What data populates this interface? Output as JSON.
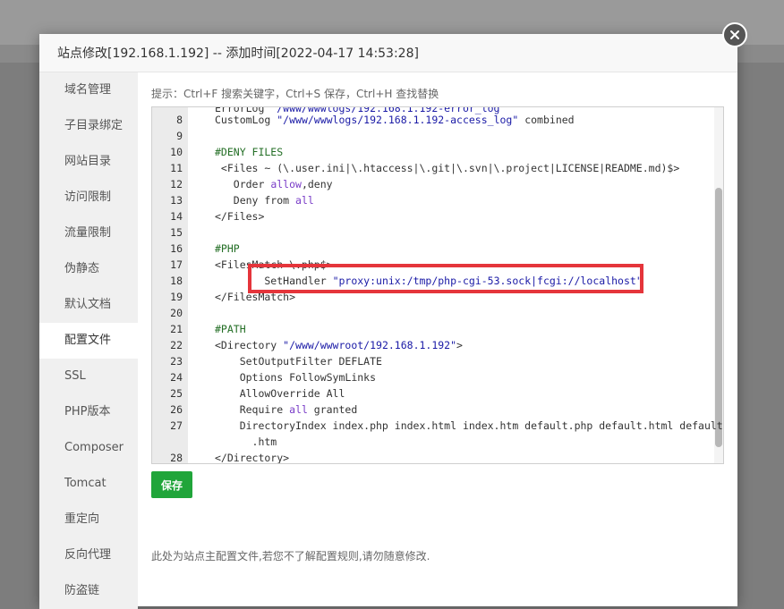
{
  "modal": {
    "title": "站点修改[192.168.1.192] -- 添加时间[2022-04-17 14:53:28]"
  },
  "sidebar": {
    "items": [
      {
        "label": "域名管理"
      },
      {
        "label": "子目录绑定"
      },
      {
        "label": "网站目录"
      },
      {
        "label": "访问限制"
      },
      {
        "label": "流量限制"
      },
      {
        "label": "伪静态"
      },
      {
        "label": "默认文档"
      },
      {
        "label": "配置文件",
        "active": true
      },
      {
        "label": "SSL"
      },
      {
        "label": "PHP版本"
      },
      {
        "label": "Composer"
      },
      {
        "label": "Tomcat"
      },
      {
        "label": "重定向"
      },
      {
        "label": "反向代理"
      },
      {
        "label": "防盗链"
      }
    ]
  },
  "editor": {
    "hint": "提示：Ctrl+F 搜索关键字，Ctrl+S 保存，Ctrl+H 查找替换",
    "partial_top_line": "ErrorLog \"/www/wwwlogs/192.168.1.192-error_log\"",
    "lines": [
      {
        "n": "8",
        "text": "CustomLog \"/www/wwwlogs/192.168.1.192-access_log\" combined"
      },
      {
        "n": "9",
        "text": ""
      },
      {
        "n": "10",
        "text": "#DENY FILES"
      },
      {
        "n": "11",
        "text": " <Files ~ (\\.user.ini|\\.htaccess|\\.git|\\.svn|\\.project|LICENSE|README.md)$>"
      },
      {
        "n": "12",
        "text": "   Order allow,deny"
      },
      {
        "n": "13",
        "text": "   Deny from all"
      },
      {
        "n": "14",
        "text": "</Files>"
      },
      {
        "n": "15",
        "text": ""
      },
      {
        "n": "16",
        "text": "#PHP"
      },
      {
        "n": "17",
        "text": "<FilesMatch \\.php$>"
      },
      {
        "n": "18",
        "text": "        SetHandler \"proxy:unix:/tmp/php-cgi-53.sock|fcgi://localhost\""
      },
      {
        "n": "19",
        "text": "</FilesMatch>"
      },
      {
        "n": "20",
        "text": ""
      },
      {
        "n": "21",
        "text": "#PATH"
      },
      {
        "n": "22",
        "text": "<Directory \"/www/wwwroot/192.168.1.192\">"
      },
      {
        "n": "23",
        "text": "    SetOutputFilter DEFLATE"
      },
      {
        "n": "24",
        "text": "    Options FollowSymLinks"
      },
      {
        "n": "25",
        "text": "    AllowOverride All"
      },
      {
        "n": "26",
        "text": "    Require all granted"
      },
      {
        "n": "27",
        "text": "    DirectoryIndex index.php index.html index.htm default.php default.html default"
      },
      {
        "n": "",
        "text": "      .htm"
      },
      {
        "n": "28",
        "text": "</Directory>"
      }
    ]
  },
  "actions": {
    "save_label": "保存"
  },
  "footer": {
    "note": "此处为站点主配置文件,若您不了解配置规则,请勿随意修改."
  },
  "colors": {
    "save": "#20a53a",
    "highlight": "#e5353b"
  }
}
